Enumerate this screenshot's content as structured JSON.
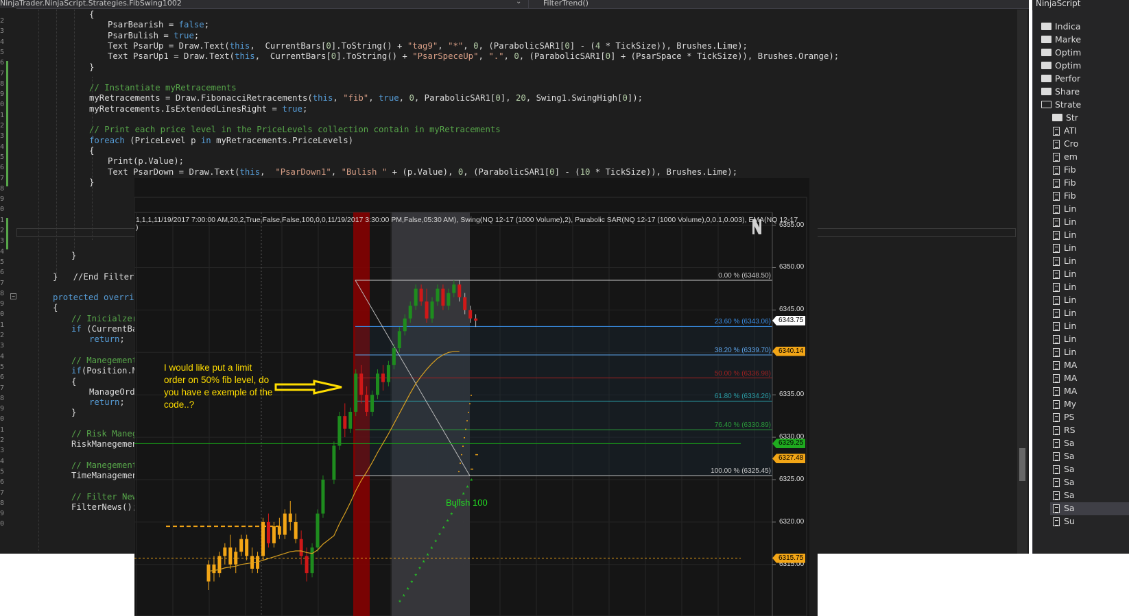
{
  "editor": {
    "breadcrumb": "NinjaTrader.NinjaScript.Strategies.FibSwing1002",
    "method": "FilterTrend()",
    "line_numbers": [
      "2",
      "3",
      "4",
      "5",
      "6",
      "7",
      "8",
      "9",
      "0",
      "1",
      "2",
      "3",
      "4",
      "5",
      "6",
      "7",
      "8",
      "9",
      "0",
      "1",
      "2",
      "3",
      "4",
      "5",
      "6",
      "7",
      "8",
      "9",
      "0",
      "1",
      "2",
      "3",
      "4",
      "5",
      "6",
      "7",
      "8",
      "9",
      "0",
      "1",
      "2",
      "3",
      "4",
      "5",
      "6",
      "7",
      "8",
      "9",
      "0"
    ],
    "lines": [
      {
        "indent": 130,
        "text": "{"
      },
      {
        "indent": 157,
        "text": "PsarBearish = false;"
      },
      {
        "indent": 157,
        "text": "PsarBulish = true;"
      },
      {
        "indent": 157,
        "text": "Text PsarUp = Draw.Text(this,  CurrentBars[0].ToString() + \"tag9\", \"*\", 0, (ParabolicSAR1[0] - (4 * TickSize)), Brushes.Lime);"
      },
      {
        "indent": 157,
        "text": "Text PsarUp1 = Draw.Text(this,  CurrentBars[0].ToString() + \"PsarSpeceUp\", \".\", 0, (ParabolicSAR1[0] + (PsarSpace * TickSize)), Brushes.Orange);"
      },
      {
        "indent": 130,
        "text": "}"
      },
      {
        "indent": 130,
        "text": ""
      },
      {
        "indent": 130,
        "text": "// Instantiate myRetracements"
      },
      {
        "indent": 130,
        "text": "myRetracements = Draw.FibonacciRetracements(this, \"fib\", true, 0, ParabolicSAR1[0], 20, Swing1.SwingHigh[0]);"
      },
      {
        "indent": 130,
        "text": "myRetracements.IsExtendedLinesRight = true;"
      },
      {
        "indent": 130,
        "text": ""
      },
      {
        "indent": 130,
        "text": "// Print each price level in the PriceLevels collection contain in myRetracements"
      },
      {
        "indent": 130,
        "text": "foreach (PriceLevel p in myRetracements.PriceLevels)"
      },
      {
        "indent": 130,
        "text": "{"
      },
      {
        "indent": 157,
        "text": "Print(p.Value);"
      },
      {
        "indent": 157,
        "text": "Text PsarDown = Draw.Text(this,  \"PsarDown1\", \"Bulish \" + (p.Value), 0, (ParabolicSAR1[0] - (10 * TickSize)), Brushes.Lime);"
      },
      {
        "indent": 130,
        "text": "}"
      },
      {
        "indent": 104,
        "text": ""
      },
      {
        "indent": 104,
        "text": ""
      },
      {
        "indent": 104,
        "text": ""
      },
      {
        "indent": 104,
        "text": ""
      },
      {
        "indent": 104,
        "text": ""
      },
      {
        "indent": 104,
        "text": ""
      },
      {
        "indent": 104,
        "text": "}"
      },
      {
        "indent": 104,
        "text": ""
      },
      {
        "indent": 77,
        "text": "}   //End FilterTr"
      },
      {
        "indent": 77,
        "text": ""
      },
      {
        "indent": 77,
        "text": "protected override"
      },
      {
        "indent": 77,
        "text": "{"
      },
      {
        "indent": 104,
        "text": "// Inicialzer"
      },
      {
        "indent": 104,
        "text": "if (CurrentBar"
      },
      {
        "indent": 130,
        "text": "return;"
      },
      {
        "indent": 104,
        "text": ""
      },
      {
        "indent": 104,
        "text": "// Manegement"
      },
      {
        "indent": 104,
        "text": "if(Position.Ma"
      },
      {
        "indent": 104,
        "text": "{"
      },
      {
        "indent": 130,
        "text": "ManageOrde"
      },
      {
        "indent": 130,
        "text": "return;"
      },
      {
        "indent": 104,
        "text": "}"
      },
      {
        "indent": 104,
        "text": ""
      },
      {
        "indent": 104,
        "text": "// Risk Manege"
      },
      {
        "indent": 104,
        "text": "RiskManegement"
      },
      {
        "indent": 104,
        "text": ""
      },
      {
        "indent": 104,
        "text": "// Manegement"
      },
      {
        "indent": 104,
        "text": "TimeManagement"
      },
      {
        "indent": 104,
        "text": ""
      },
      {
        "indent": 104,
        "text": "// Filter News"
      },
      {
        "indent": 104,
        "text": "FilterNews();"
      }
    ]
  },
  "solution": {
    "title": "NinjaScript",
    "items": [
      {
        "type": "folder",
        "label": "Indica",
        "level": 0
      },
      {
        "type": "folder",
        "label": "Marke",
        "level": 0
      },
      {
        "type": "folder",
        "label": "Optim",
        "level": 0
      },
      {
        "type": "folder",
        "label": "Optim",
        "level": 0
      },
      {
        "type": "folder",
        "label": "Perfor",
        "level": 0
      },
      {
        "type": "folder",
        "label": "Share",
        "level": 0
      },
      {
        "type": "folder-open",
        "label": "Strate",
        "level": 0
      },
      {
        "type": "folder",
        "label": "Str",
        "level": 1
      },
      {
        "type": "doc",
        "label": "ATI",
        "level": 1
      },
      {
        "type": "doc",
        "label": "Cro",
        "level": 1
      },
      {
        "type": "doc",
        "label": "em",
        "level": 1
      },
      {
        "type": "doc",
        "label": "Fib",
        "level": 1
      },
      {
        "type": "doc",
        "label": "Fib",
        "level": 1
      },
      {
        "type": "doc",
        "label": "Fib",
        "level": 1
      },
      {
        "type": "doc",
        "label": "Lin",
        "level": 1
      },
      {
        "type": "doc",
        "label": "Lin",
        "level": 1
      },
      {
        "type": "doc",
        "label": "Lin",
        "level": 1
      },
      {
        "type": "doc",
        "label": "Lin",
        "level": 1
      },
      {
        "type": "doc",
        "label": "Lin",
        "level": 1
      },
      {
        "type": "doc",
        "label": "Lin",
        "level": 1
      },
      {
        "type": "doc",
        "label": "Lin",
        "level": 1
      },
      {
        "type": "doc",
        "label": "Lin",
        "level": 1
      },
      {
        "type": "doc",
        "label": "Lin",
        "level": 1
      },
      {
        "type": "doc",
        "label": "Lin",
        "level": 1
      },
      {
        "type": "doc",
        "label": "Lin",
        "level": 1
      },
      {
        "type": "doc",
        "label": "Lin",
        "level": 1
      },
      {
        "type": "doc",
        "label": "MA",
        "level": 1
      },
      {
        "type": "doc",
        "label": "MA",
        "level": 1
      },
      {
        "type": "doc",
        "label": "MA",
        "level": 1
      },
      {
        "type": "doc",
        "label": "My",
        "level": 1
      },
      {
        "type": "doc",
        "label": "PS",
        "level": 1
      },
      {
        "type": "doc",
        "label": "RS",
        "level": 1
      },
      {
        "type": "doc",
        "label": "Sa",
        "level": 1
      },
      {
        "type": "doc",
        "label": "Sa",
        "level": 1
      },
      {
        "type": "doc",
        "label": "Sa",
        "level": 1
      },
      {
        "type": "doc",
        "label": "Sa",
        "level": 1
      },
      {
        "type": "doc",
        "label": "Sa",
        "level": 1
      },
      {
        "type": "doc",
        "label": "Sa",
        "level": 1,
        "selected": true
      },
      {
        "type": "doc",
        "label": "Su",
        "level": 1
      }
    ]
  },
  "chart": {
    "info_line": "1,1,1,11/19/2017 7:00:00 AM,20,2,True,False,False,100,0,0,11/19/2017 3:30:00 PM,False,05:30 AM), Swing(NQ 12-17 (1000 Volume),2), Parabolic SAR(NQ 12-17 (1000 Volume),0,0.1,0.003), EMA(NQ 12-17",
    "info_line2": ")",
    "comment": "I would like put a limit order on 50% fib level, do you have e exemple of the code..?",
    "bulish_label": "Bulish 100",
    "colors": {
      "up": "#1e8c1e",
      "down": "#d01818",
      "ema": "#d8a020",
      "psar": "#22dd22",
      "highlight_red": "#8b0000",
      "highlight_gray": "#3a3a3e"
    },
    "y_axis": {
      "min": 6314.5,
      "max": 6356.5,
      "ticks": [
        "6355.00",
        "6350.00",
        "6345.00",
        "6340.00",
        "6335.00",
        "6330.00",
        "6325.00",
        "6320.00",
        "6315.00"
      ]
    },
    "price_tags": [
      {
        "value": "6343.75",
        "price": 6343.75,
        "bg": "#ffffff",
        "fg": "#000000"
      },
      {
        "value": "6340.14",
        "price": 6340.14,
        "bg": "#f2a516",
        "fg": "#000000"
      },
      {
        "value": "6329.25",
        "price": 6329.25,
        "bg": "#1faa1f",
        "fg": "#000000"
      },
      {
        "value": "6327.48",
        "price": 6327.48,
        "bg": "#f2a516",
        "fg": "#000000"
      },
      {
        "value": "6315.75",
        "price": 6315.75,
        "bg": "#f2a516",
        "fg": "#000000"
      }
    ],
    "fib_levels": [
      {
        "label": "0.00 % (6348.50)",
        "price": 6348.5,
        "color": "#c8c8c8"
      },
      {
        "label": "23.60 % (6343.06)",
        "price": 6343.06,
        "color": "#3a8ee6"
      },
      {
        "label": "38.20 % (6339.70)",
        "price": 6339.7,
        "color": "#5fa8f0"
      },
      {
        "label": "50.00 % (6336.98)",
        "price": 6336.98,
        "color": "#a02020"
      },
      {
        "label": "61.80 % (6334.26)",
        "price": 6334.26,
        "color": "#2a9fa8"
      },
      {
        "label": "76.40 % (6330.89)",
        "price": 6330.89,
        "color": "#2a9a3a"
      },
      {
        "label": "100.00 % (6325.45)",
        "price": 6325.45,
        "color": "#c8c8c8"
      }
    ],
    "candles": [
      [
        6313.0,
        6315.5,
        6312.0,
        6315.0
      ],
      [
        6315.0,
        6316.0,
        6313.0,
        6314.0
      ],
      [
        6314.0,
        6316.5,
        6313.5,
        6316.0
      ],
      [
        6316.0,
        6317.5,
        6315.0,
        6317.0
      ],
      [
        6317.0,
        6318.5,
        6314.5,
        6315.0
      ],
      [
        6315.0,
        6317.0,
        6314.0,
        6316.5
      ],
      [
        6316.5,
        6318.5,
        6316.0,
        6318.0
      ],
      [
        6318.0,
        6318.5,
        6315.5,
        6316.0
      ],
      [
        6316.0,
        6317.0,
        6314.0,
        6314.5
      ],
      [
        6314.5,
        6316.5,
        6314.0,
        6316.0
      ],
      [
        6316.0,
        6320.5,
        6315.5,
        6320.0
      ],
      [
        6320.0,
        6321.0,
        6317.0,
        6317.5
      ],
      [
        6317.5,
        6320.0,
        6317.0,
        6319.5
      ],
      [
        6319.5,
        6320.5,
        6318.0,
        6318.5
      ],
      [
        6318.5,
        6321.5,
        6318.0,
        6321.0
      ],
      [
        6321.0,
        6322.5,
        6319.0,
        6320.0
      ],
      [
        6320.0,
        6321.0,
        6317.5,
        6318.0
      ],
      [
        6318.0,
        6319.0,
        6315.0,
        6316.0
      ],
      [
        6316.0,
        6317.0,
        6313.0,
        6314.0
      ],
      [
        6314.0,
        6317.5,
        6313.5,
        6317.0
      ],
      [
        6317.0,
        6321.5,
        6316.5,
        6321.0
      ],
      [
        6321.0,
        6325.5,
        6320.5,
        6325.0
      ],
      [
        6325.0,
        6329.5,
        6324.5,
        6329.0
      ],
      [
        6329.0,
        6333.0,
        6328.5,
        6332.5
      ],
      [
        6332.5,
        6334.0,
        6330.0,
        6331.0
      ],
      [
        6331.0,
        6333.5,
        6330.5,
        6333.0
      ],
      [
        6333.0,
        6338.0,
        6332.5,
        6337.5
      ],
      [
        6337.5,
        6338.5,
        6334.0,
        6335.0
      ],
      [
        6335.0,
        6336.0,
        6332.5,
        6333.0
      ],
      [
        6333.0,
        6335.5,
        6332.5,
        6335.0
      ],
      [
        6335.0,
        6338.0,
        6334.5,
        6337.5
      ],
      [
        6337.5,
        6338.5,
        6335.5,
        6336.5
      ],
      [
        6336.5,
        6339.0,
        6336.0,
        6338.5
      ],
      [
        6338.5,
        6341.0,
        6338.0,
        6340.5
      ],
      [
        6340.5,
        6343.0,
        6340.0,
        6342.5
      ],
      [
        6342.5,
        6344.5,
        6342.0,
        6344.0
      ],
      [
        6344.0,
        6346.0,
        6343.5,
        6345.5
      ],
      [
        6345.5,
        6348.0,
        6345.0,
        6347.5
      ],
      [
        6347.5,
        6348.0,
        6345.5,
        6346.0
      ],
      [
        6346.0,
        6347.5,
        6343.5,
        6344.0
      ],
      [
        6344.0,
        6346.5,
        6343.5,
        6346.0
      ],
      [
        6346.0,
        6348.0,
        6345.5,
        6347.5
      ],
      [
        6347.5,
        6348.0,
        6345.0,
        6345.5
      ],
      [
        6345.5,
        6347.5,
        6345.0,
        6347.0
      ],
      [
        6347.0,
        6348.5,
        6346.5,
        6348.0
      ],
      [
        6348.0,
        6348.5,
        6346.0,
        6346.5
      ],
      [
        6346.5,
        6347.0,
        6344.5,
        6345.0
      ],
      [
        6345.0,
        6345.5,
        6343.5,
        6344.0
      ],
      [
        6344.0,
        6344.5,
        6343.0,
        6343.75
      ]
    ],
    "ema": [
      6314.2,
      6314.3,
      6314.4,
      6314.6,
      6314.7,
      6314.8,
      6315.0,
      6315.1,
      6315.2,
      6315.3,
      6315.5,
      6315.7,
      6315.9,
      6316.1,
      6316.3,
      6316.5,
      6316.6,
      6316.6,
      6316.4,
      6316.3,
      6316.7,
      6317.4,
      6318.4,
      6319.8,
      6321.0,
      6322.3,
      6323.7,
      6324.9,
      6325.9,
      6327.0,
      6328.2,
      6329.3,
      6330.4,
      6331.6,
      6332.8,
      6334.0,
      6335.2,
      6336.3,
      6337.2,
      6338.0,
      6338.7,
      6339.3,
      6339.7,
      6340.0,
      6340.1,
      6340.14
    ],
    "psar": [
      6310.5,
      6311.2,
      6312.0,
      6312.8,
      6313.6,
      6314.4,
      6315.2,
      6316.0,
      6316.8,
      6317.6,
      6318.4,
      6319.2,
      6320.0,
      6320.8,
      6321.6,
      6322.4,
      6323.2,
      6324.0,
      6324.8
    ],
    "psar_dots": [
      6326.0,
      6327.0,
      6328.0,
      6329.0,
      6330.0,
      6331.0,
      6332.0,
      6333.0,
      6334.0,
      6335.0
    ]
  }
}
